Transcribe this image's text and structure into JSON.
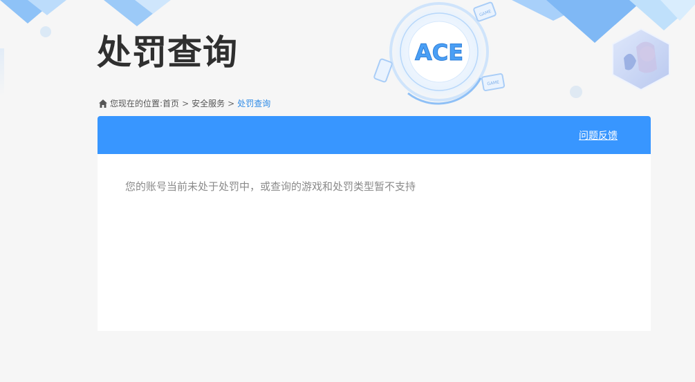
{
  "page": {
    "title": "处罚查询"
  },
  "breadcrumb": {
    "prefix": "您现在的位置:",
    "items": [
      {
        "label": "首页"
      },
      {
        "label": "安全服务"
      },
      {
        "label": "处罚查询"
      }
    ],
    "separator": ">"
  },
  "panel": {
    "feedback_label": "问题反馈",
    "message": "您的账号当前未处于处罚中，或查询的游戏和处罚类型暂不支持"
  },
  "decor": {
    "logo_text": "ACE",
    "game_tag": "GAME"
  },
  "colors": {
    "accent": "#3896ff",
    "current_crumb": "#2d8ae6",
    "background": "#f6f6f6"
  }
}
